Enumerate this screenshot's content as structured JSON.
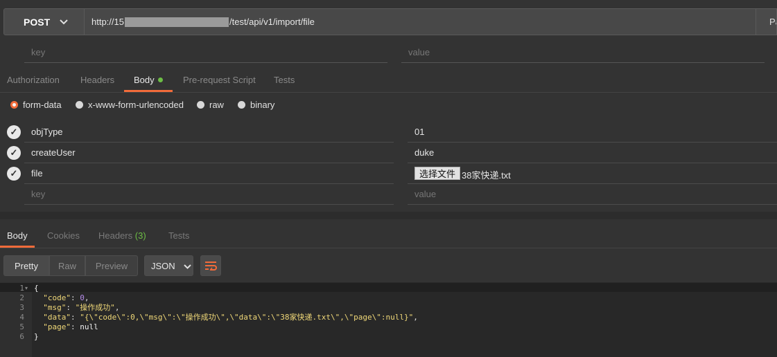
{
  "request": {
    "method": "POST",
    "url_prefix": "http://15",
    "url_suffix": "/test/api/v1/import/file",
    "params_label": "Pa",
    "key_placeholder": "key",
    "value_placeholder": "value"
  },
  "request_tabs": [
    {
      "label": "Authorization"
    },
    {
      "label": "Headers"
    },
    {
      "label": "Body"
    },
    {
      "label": "Pre-request Script"
    },
    {
      "label": "Tests"
    }
  ],
  "body_modes": [
    {
      "label": "form-data",
      "selected": true
    },
    {
      "label": "x-www-form-urlencoded",
      "selected": false
    },
    {
      "label": "raw",
      "selected": false
    },
    {
      "label": "binary",
      "selected": false
    }
  ],
  "form_rows": [
    {
      "key": "objType",
      "value": "01"
    },
    {
      "key": "createUser",
      "value": "duke"
    },
    {
      "key": "file",
      "file_button": "选择文件",
      "value": "38家快递.txt"
    }
  ],
  "new_row": {
    "key_placeholder": "key",
    "value_placeholder": "value"
  },
  "response_tabs": [
    {
      "label": "Body"
    },
    {
      "label": "Cookies"
    },
    {
      "label": "Headers",
      "count": "(3)"
    },
    {
      "label": "Tests"
    }
  ],
  "view_modes": [
    "Pretty",
    "Raw",
    "Preview"
  ],
  "format": "JSON",
  "code_lines": [
    "1",
    "2",
    "3",
    "4",
    "5",
    "6"
  ],
  "response_json": {
    "open": "{",
    "close": "}",
    "code_key": "\"code\"",
    "code_val": "0",
    "msg_key": "\"msg\"",
    "msg_val": "\"操作成功\"",
    "data_key": "\"data\"",
    "data_val": "\"{\\\"code\\\":0,\\\"msg\\\":\\\"操作成功\\\",\\\"data\\\":\\\"38家快递.txt\\\",\\\"page\\\":null}\"",
    "page_key": "\"page\"",
    "page_val": "null"
  },
  "colors": {
    "accent": "#f26b3a",
    "dot": "#6dbe45",
    "background": "#333333"
  }
}
